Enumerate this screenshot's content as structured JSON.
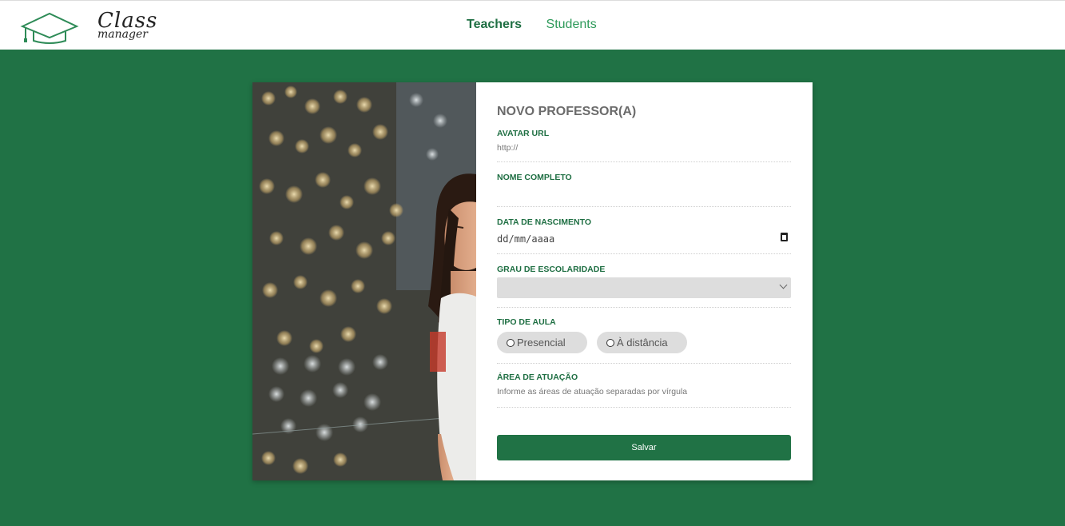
{
  "header": {
    "logo_line1": "Class",
    "logo_line2": "manager",
    "nav": [
      {
        "label": "Teachers",
        "active": true
      },
      {
        "label": "Students",
        "active": false
      }
    ]
  },
  "form": {
    "title": "NOVO PROFESSOR(A)",
    "avatar_label": "AVATAR URL",
    "avatar_placeholder": "http://",
    "name_label": "NOME COMPLETO",
    "name_value": "",
    "birth_label": "DATA DE NASCIMENTO",
    "birth_placeholder": "dd/mm/aaaa",
    "education_label": "GRAU DE ESCOLARIDADE",
    "education_value": "",
    "class_type_label": "TIPO DE AULA",
    "class_type_options": [
      "Presencial",
      "À distância"
    ],
    "area_label": "ÁREA DE ATUAÇÃO",
    "area_placeholder": "Informe as áreas de atuação separadas por vírgula",
    "save_label": "Salvar"
  },
  "icons": {
    "logo": "graduation-cap-icon",
    "date": "calendar-icon",
    "select": "chevron-down-icon",
    "radio": "radio-unchecked-icon"
  },
  "colors": {
    "brand": "#207245",
    "active_nav": "#1f6f43",
    "inactive_nav": "#2e9a5a"
  }
}
